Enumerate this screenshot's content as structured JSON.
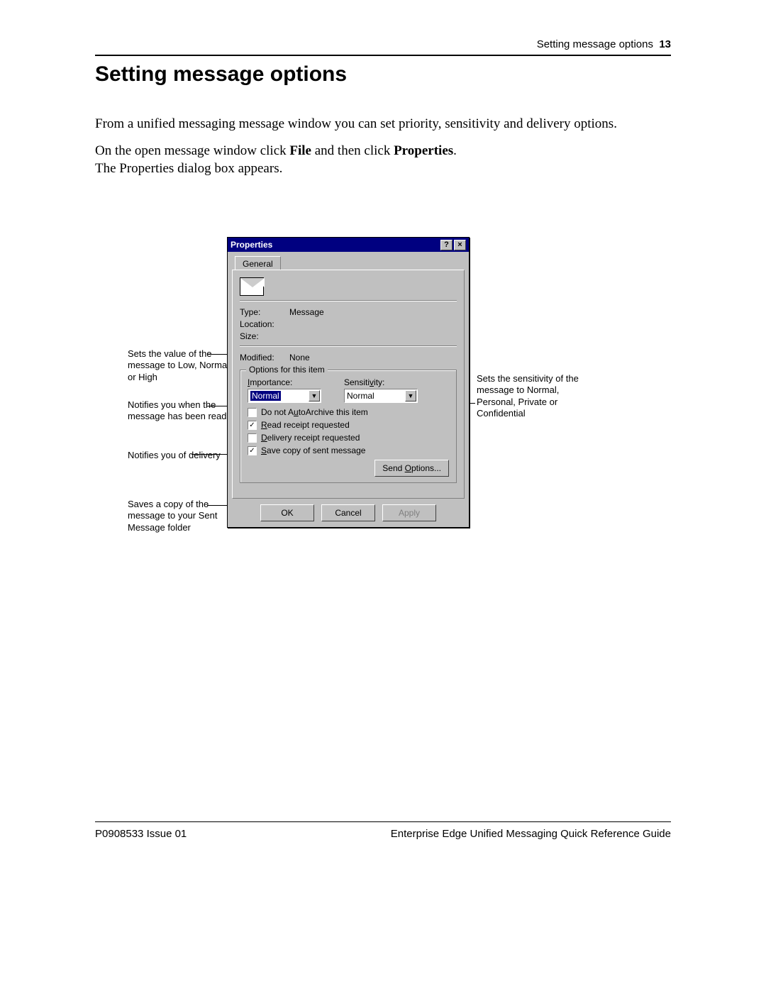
{
  "header": {
    "section": "Setting message options",
    "pagenum": "13"
  },
  "title": "Setting message options",
  "paragraphs": {
    "p1": "From a unified messaging message window you can set priority, sensitivity and delivery options.",
    "p2a": "On the open message window click ",
    "p2b": "File",
    "p2c": " and then click ",
    "p2d": "Properties",
    "p2e": ".",
    "p3": "The Properties dialog box appears."
  },
  "callouts": {
    "importance": "Sets the value of the message to Low, Normal or High",
    "read": "Notifies you when the message has been read",
    "delivery": "Notifies you of delivery",
    "save": "Saves a copy of the message to your Sent Message folder",
    "sensitivity": "Sets the sensitivity of the message to Normal, Personal, Private or Confidential"
  },
  "dialog": {
    "title": "Properties",
    "titlebar": {
      "help": "?",
      "close": "×"
    },
    "tab": "General",
    "fields": {
      "type_label": "Type:",
      "type_value": "Message",
      "location_label": "Location:",
      "location_value": "",
      "size_label": "Size:",
      "size_value": "",
      "modified_label": "Modified:",
      "modified_value": "None"
    },
    "group": {
      "legend": "Options for this item",
      "importance_label": "Importance:",
      "importance_value": "Normal",
      "sensitivity_label": "Sensitivity:",
      "sensitivity_value": "Normal",
      "chk_autoarchive": "Do not AutoArchive this item",
      "chk_read": "Read receipt requested",
      "chk_delivery": "Delivery receipt requested",
      "chk_save": "Save copy of sent message",
      "send_options": "Send Options..."
    },
    "buttons": {
      "ok": "OK",
      "cancel": "Cancel",
      "apply": "Apply"
    }
  },
  "footer": {
    "left": "P0908533 Issue 01",
    "right": "Enterprise Edge Unified Messaging Quick Reference Guide"
  }
}
